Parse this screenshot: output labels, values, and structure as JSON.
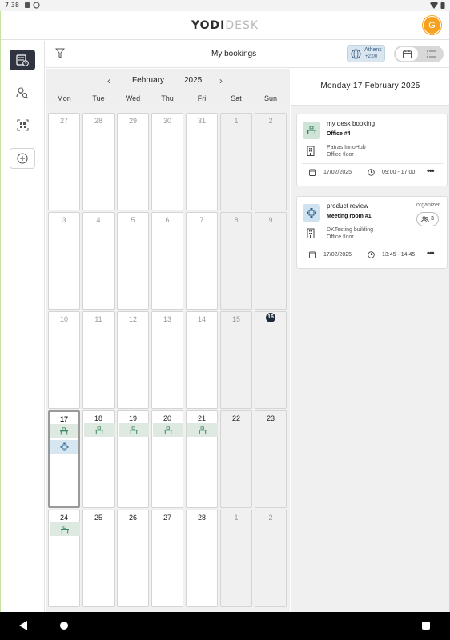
{
  "status_bar": {
    "time": "7:38"
  },
  "app": {
    "logo_left": "YODI",
    "logo_right": "DESK",
    "user_initial": "G"
  },
  "nav": [
    {
      "icon": "bookings-list-icon",
      "active": true
    },
    {
      "icon": "find-person-icon",
      "active": false
    },
    {
      "icon": "qr-scan-icon",
      "active": false
    },
    {
      "icon": "add-icon",
      "active": false
    }
  ],
  "toolbar": {
    "title": "My bookings",
    "timezone_city": "Athens",
    "timezone_offset": "+2:00"
  },
  "calendar": {
    "month": "February",
    "year": "2025",
    "weekdays": [
      "Mon",
      "Tue",
      "Wed",
      "Thu",
      "Fri",
      "Sat",
      "Sun"
    ],
    "weeks": [
      [
        {
          "day": "27",
          "outside": true,
          "weekend": false,
          "bookings": []
        },
        {
          "day": "28",
          "outside": true,
          "weekend": false,
          "bookings": []
        },
        {
          "day": "29",
          "outside": true,
          "weekend": false,
          "bookings": []
        },
        {
          "day": "30",
          "outside": true,
          "weekend": false,
          "bookings": []
        },
        {
          "day": "31",
          "outside": true,
          "weekend": false,
          "bookings": []
        },
        {
          "day": "1",
          "outside": true,
          "weekend": true,
          "bookings": []
        },
        {
          "day": "2",
          "outside": true,
          "weekend": true,
          "bookings": []
        }
      ],
      [
        {
          "day": "3",
          "outside": true,
          "weekend": false,
          "bookings": []
        },
        {
          "day": "4",
          "outside": true,
          "weekend": false,
          "bookings": []
        },
        {
          "day": "5",
          "outside": true,
          "weekend": false,
          "bookings": []
        },
        {
          "day": "6",
          "outside": true,
          "weekend": false,
          "bookings": []
        },
        {
          "day": "7",
          "outside": true,
          "weekend": false,
          "bookings": []
        },
        {
          "day": "8",
          "outside": true,
          "weekend": true,
          "bookings": []
        },
        {
          "day": "9",
          "outside": true,
          "weekend": true,
          "bookings": []
        }
      ],
      [
        {
          "day": "10",
          "outside": true,
          "weekend": false,
          "bookings": []
        },
        {
          "day": "11",
          "outside": true,
          "weekend": false,
          "bookings": []
        },
        {
          "day": "12",
          "outside": true,
          "weekend": false,
          "bookings": []
        },
        {
          "day": "13",
          "outside": true,
          "weekend": false,
          "bookings": []
        },
        {
          "day": "14",
          "outside": true,
          "weekend": false,
          "bookings": []
        },
        {
          "day": "15",
          "outside": true,
          "weekend": true,
          "bookings": []
        },
        {
          "day": "16",
          "outside": false,
          "weekend": true,
          "current": true,
          "bookings": []
        }
      ],
      [
        {
          "day": "17",
          "outside": false,
          "weekend": false,
          "selected": true,
          "bookings": [
            "desk",
            "room"
          ]
        },
        {
          "day": "18",
          "outside": false,
          "weekend": false,
          "bookings": [
            "desk"
          ]
        },
        {
          "day": "19",
          "outside": false,
          "weekend": false,
          "bookings": [
            "desk"
          ]
        },
        {
          "day": "20",
          "outside": false,
          "weekend": false,
          "bookings": [
            "desk"
          ]
        },
        {
          "day": "21",
          "outside": false,
          "weekend": false,
          "bookings": [
            "desk"
          ]
        },
        {
          "day": "22",
          "outside": false,
          "weekend": true,
          "bookings": []
        },
        {
          "day": "23",
          "outside": false,
          "weekend": true,
          "bookings": []
        }
      ],
      [
        {
          "day": "24",
          "outside": false,
          "weekend": false,
          "bookings": [
            "desk"
          ]
        },
        {
          "day": "25",
          "outside": false,
          "weekend": false,
          "bookings": []
        },
        {
          "day": "26",
          "outside": false,
          "weekend": false,
          "bookings": []
        },
        {
          "day": "27",
          "outside": false,
          "weekend": false,
          "bookings": []
        },
        {
          "day": "28",
          "outside": false,
          "weekend": false,
          "bookings": []
        },
        {
          "day": "1",
          "outside": true,
          "weekend": true,
          "bookings": []
        },
        {
          "day": "2",
          "outside": true,
          "weekend": true,
          "bookings": []
        }
      ]
    ]
  },
  "day_panel": {
    "date_label": "Monday  17  February  2025",
    "bookings": [
      {
        "type": "desk",
        "title": "my desk booking",
        "resource": "Office #4",
        "building": "Patras InnoHub",
        "floor": "Office floor",
        "date": "17/02/2025",
        "time": "09:00 - 17:00",
        "organizer_label": "",
        "attendees": ""
      },
      {
        "type": "room",
        "title": "product review",
        "resource": "Meeting room #1",
        "building": "DKTesting building",
        "floor": "Office floor",
        "date": "17/02/2025",
        "time": "13:45 - 14:45",
        "organizer_label": "organizer",
        "attendees": "3"
      }
    ]
  },
  "colors": {
    "accent_dark": "#2f3440",
    "avatar": "#f6a120",
    "desk_booking": "#dde9e1",
    "room_booking": "#d7e7f2",
    "timezone_chip": "#d9e5ef"
  }
}
